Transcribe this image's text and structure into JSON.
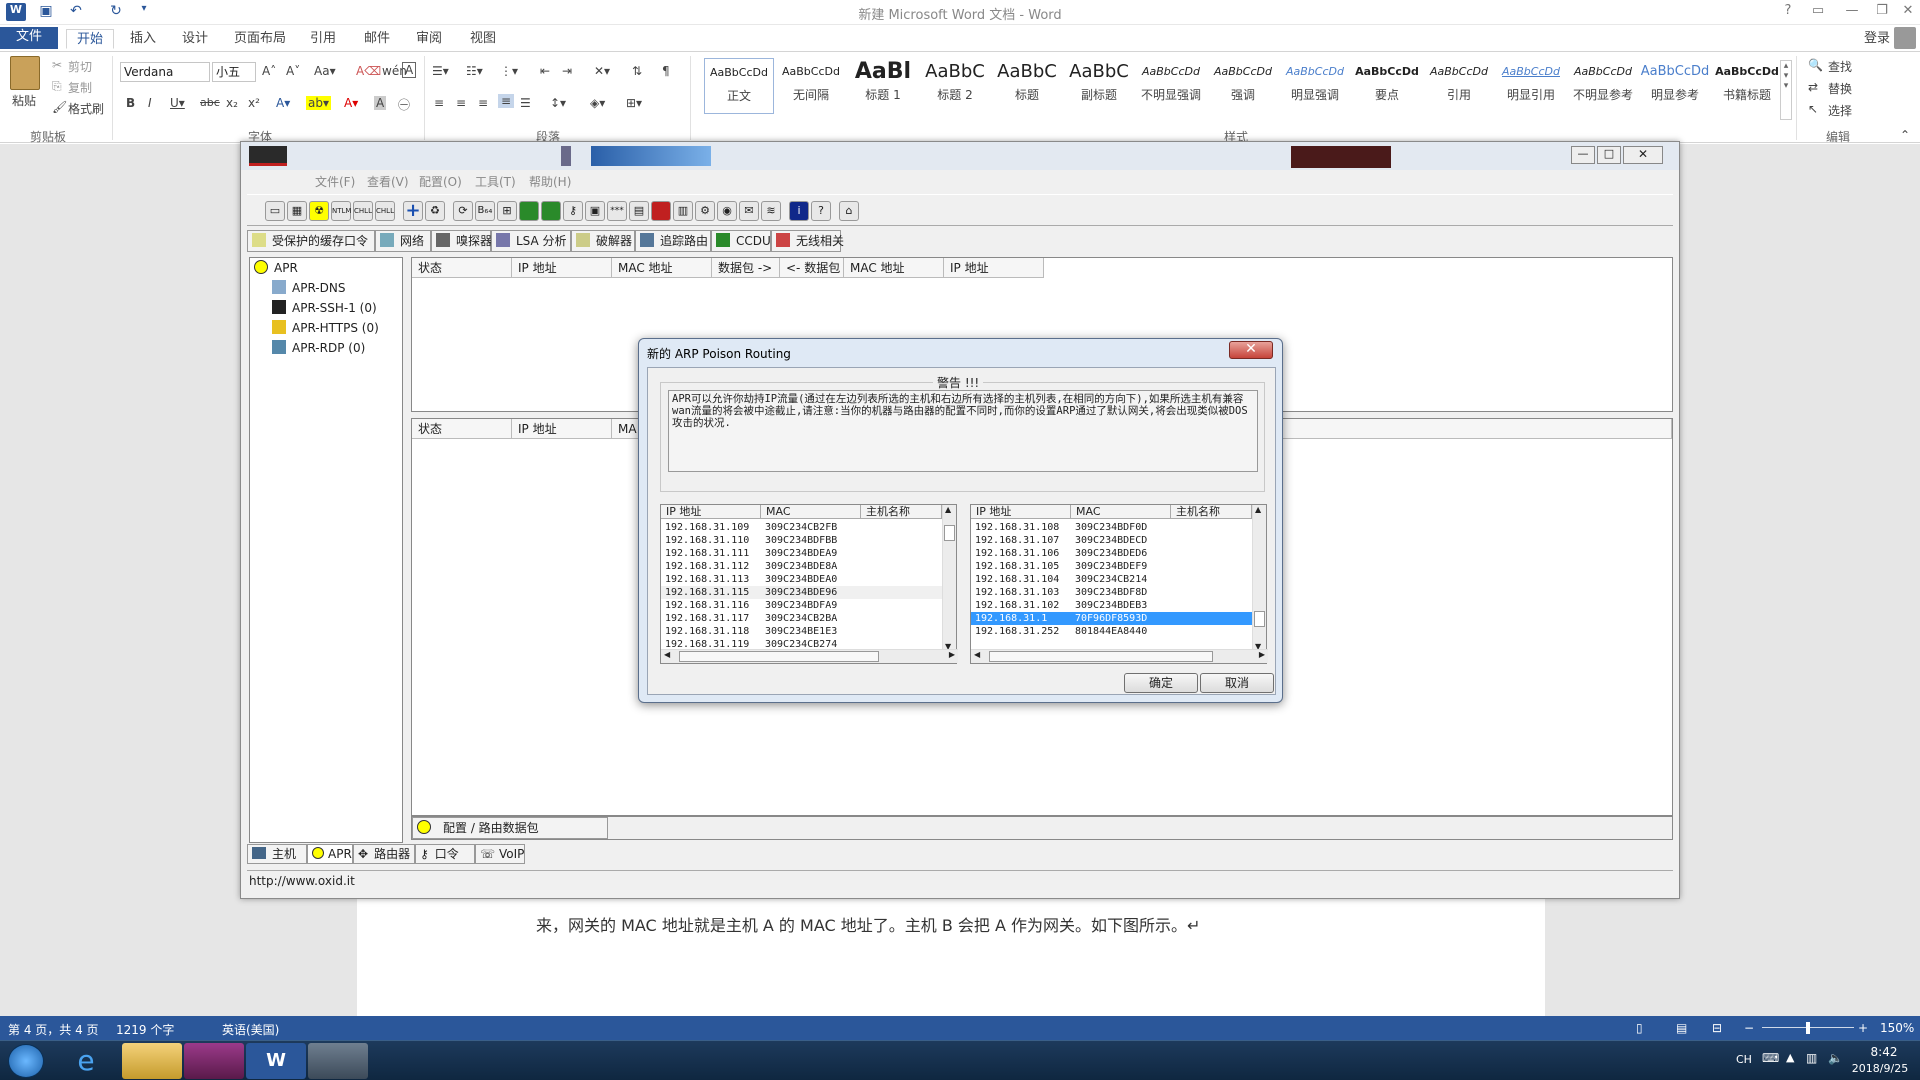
{
  "word": {
    "title": "新建 Microsoft Word 文档 - Word",
    "login": "登录",
    "tabs": [
      "文件",
      "开始",
      "插入",
      "设计",
      "页面布局",
      "引用",
      "邮件",
      "审阅",
      "视图"
    ],
    "clipboard": {
      "paste": "粘贴",
      "cut": "剪切",
      "copy": "复制",
      "format_painter": "格式刷",
      "group": "剪贴板"
    },
    "font": {
      "name": "Verdana",
      "size": "小五",
      "group": "字体"
    },
    "paragraph_group": "段落",
    "styles": [
      {
        "sample": "AaBbCcDd",
        "name": "正文"
      },
      {
        "sample": "AaBbCcDd",
        "name": "无间隔"
      },
      {
        "sample": "AaBl",
        "name": "标题 1"
      },
      {
        "sample": "AaBbC",
        "name": "标题 2"
      },
      {
        "sample": "AaBbC",
        "name": "标题"
      },
      {
        "sample": "AaBbC",
        "name": "副标题"
      },
      {
        "sample": "AaBbCcDd",
        "name": "不明显强调"
      },
      {
        "sample": "AaBbCcDd",
        "name": "强调"
      },
      {
        "sample": "AaBbCcDd",
        "name": "明显强调"
      },
      {
        "sample": "AaBbCcDd",
        "name": "要点"
      },
      {
        "sample": "AaBbCcDd",
        "name": "引用"
      },
      {
        "sample": "AaBbCcDd",
        "name": "明显引用"
      },
      {
        "sample": "AaBbCcDd",
        "name": "不明显参考"
      },
      {
        "sample": "AaBbCcDd",
        "name": "明显参考"
      },
      {
        "sample": "AaBbCcDd",
        "name": "书籍标题"
      }
    ],
    "styles_group": "样式",
    "editing": {
      "find": "查找",
      "replace": "替换",
      "select": "选择",
      "group": "编辑"
    },
    "doc_text": "来，网关的 MAC 地址就是主机 A 的 MAC 地址了。主机 B 会把 A 作为网关。如下图所示。↵",
    "status": {
      "page": "第 4 页，共 4 页",
      "words": "1219 个字",
      "lang": "英语(美国)",
      "zoom": "150%"
    }
  },
  "taskbar": {
    "lang": "CH",
    "time": "8:42",
    "date": "2018/9/25"
  },
  "cain": {
    "menu": [
      "文件(F)",
      "查看(V)",
      "配置(O)",
      "工具(T)",
      "帮助(H)"
    ],
    "tabs": [
      "受保护的缓存口令",
      "网络",
      "嗅探器",
      "LSA 分析",
      "破解器",
      "追踪路由",
      "CCDU",
      "无线相关"
    ],
    "tree": [
      {
        "label": "APR"
      },
      {
        "label": "APR-DNS"
      },
      {
        "label": "APR-SSH-1 (0)"
      },
      {
        "label": "APR-HTTPS (0)"
      },
      {
        "label": "APR-RDP (0)"
      }
    ],
    "gridA_headers": [
      "状态",
      "IP 地址",
      "MAC 地址",
      "数据包 ->",
      "<- 数据包",
      "MAC 地址",
      "IP 地址"
    ],
    "gridB_headers": [
      "状态",
      "IP 地址",
      "MA"
    ],
    "footer_tab": "配置 / 路由数据包",
    "bottom_tabs": [
      "主机",
      "APR",
      "路由器",
      "口令",
      "VoIP"
    ],
    "status_url": "http://www.oxid.it"
  },
  "dialog": {
    "title": "新的 ARP Poison Routing",
    "warning_label": "警告 !!!",
    "warning_text": "APR可以允许你劫持IP流量(通过在左边列表所选的主机和右边所有选择的主机列表,在相同的方向下),如果所选主机有兼容wan流量的将会被中途截止,请注意:当你的机器与路由器的配置不同时,而你的设置ARP通过了默认网关,将会出现类似被DOS攻击的状况.",
    "columns": [
      "IP 地址",
      "MAC",
      "主机名称"
    ],
    "left_rows": [
      [
        "192.168.31.109",
        "309C234CB2FB"
      ],
      [
        "192.168.31.110",
        "309C234BDFBB"
      ],
      [
        "192.168.31.111",
        "309C234BDEA9"
      ],
      [
        "192.168.31.112",
        "309C234BDE8A"
      ],
      [
        "192.168.31.113",
        "309C234BDEA0"
      ],
      [
        "192.168.31.115",
        "309C234BDE96"
      ],
      [
        "192.168.31.116",
        "309C234BDFA9"
      ],
      [
        "192.168.31.117",
        "309C234CB2BA"
      ],
      [
        "192.168.31.118",
        "309C234BE1E3"
      ],
      [
        "192.168.31.119",
        "309C234CB274"
      ]
    ],
    "right_rows": [
      [
        "192.168.31.108",
        "309C234BDF0D"
      ],
      [
        "192.168.31.107",
        "309C234BDECD"
      ],
      [
        "192.168.31.106",
        "309C234BDED6"
      ],
      [
        "192.168.31.105",
        "309C234BDEF9"
      ],
      [
        "192.168.31.104",
        "309C234CB214"
      ],
      [
        "192.168.31.103",
        "309C234BDF8D"
      ],
      [
        "192.168.31.102",
        "309C234BDEB3"
      ],
      [
        "192.168.31.1",
        "70F96DF8593D"
      ],
      [
        "192.168.31.252",
        "801844EA8440"
      ]
    ],
    "selected_right_ip": "192.168.31.1",
    "ok": "确定",
    "cancel": "取消"
  }
}
